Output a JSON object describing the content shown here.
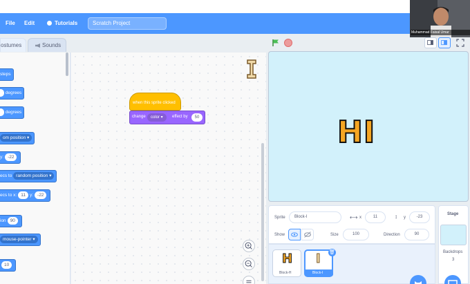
{
  "menubar": {
    "file": "File",
    "edit": "Edit",
    "tutorials": "Tutorials",
    "project_title": "Scratch Project"
  },
  "tabs": {
    "costumes": "ostumes",
    "sounds": "Sounds"
  },
  "palette": {
    "steps": "steps",
    "degrees_1": "degrees",
    "degrees_2": "degrees",
    "random_position": "om position",
    "y_label": "y:",
    "y_value": "-22",
    "glide_to": "ecs to",
    "glide_target": "random position",
    "glide_xy_prefix": "ecs to x:",
    "glide_x": "11",
    "glide_y_label": "y:",
    "glide_y": "-22",
    "direction_value": "90",
    "direction_prefix": "ion",
    "point_towards": "mouse-pointer",
    "last_value": "10"
  },
  "script": {
    "hat_label": "when this sprite clicked",
    "change_label": "change",
    "effect_option": "color",
    "effect_by_label": "effect by",
    "effect_value": "50"
  },
  "stage": {
    "text": "HI"
  },
  "sprite_info": {
    "sprite_label": "Sprite",
    "sprite_name": "Block-I",
    "x_label": "x",
    "x_value": "11",
    "y_label": "y",
    "y_value": "-23",
    "show_label": "Show",
    "size_label": "Size",
    "size_value": "100",
    "direction_label": "Direction",
    "direction_value": "90"
  },
  "sprites": [
    {
      "name": "Block-H",
      "glyph": "H",
      "selected": false
    },
    {
      "name": "Block-I",
      "glyph": "I",
      "selected": true
    }
  ],
  "stage_pane": {
    "title": "Stage",
    "backdrops_label": "Backdrops",
    "backdrops_count": "3"
  },
  "webcam": {
    "caption": "Muhammad Faisal Umar"
  },
  "colors": {
    "accent": "#4c97ff",
    "events": "#ffbf00",
    "looks": "#9966ff",
    "stage_bg": "#d2f1fb"
  }
}
